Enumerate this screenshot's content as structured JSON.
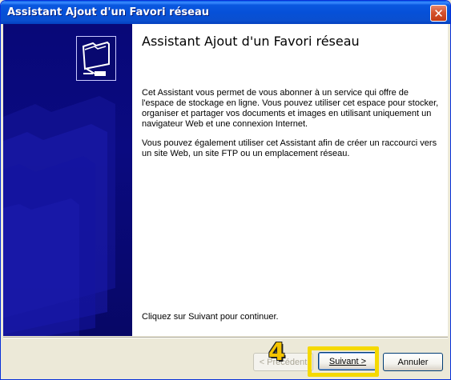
{
  "window": {
    "title": "Assistant Ajout d'un Favori réseau",
    "close_glyph": "✕"
  },
  "content": {
    "heading": "Assistant Ajout d'un Favori réseau",
    "paragraph1": "Cet Assistant vous permet de vous abonner à un service qui offre de l'espace de stockage en ligne. Vous pouvez utiliser cet espace pour stocker, organiser et partager vos documents et images en utilisant uniquement un navigateur Web et une connexion Internet.",
    "paragraph2": "Vous pouvez également utiliser cet Assistant afin de créer un raccourci vers un site Web, un site FTP ou un emplacement réseau.",
    "footer": "Cliquez sur Suivant pour continuer."
  },
  "buttons": {
    "previous": "< Précédent",
    "next": "Suivant >",
    "cancel": "Annuler"
  },
  "annotation": {
    "step": "4",
    "highlight_color": "#f5d900"
  },
  "icons": {
    "close": "close-icon",
    "wizard": "network-folder-icon"
  }
}
